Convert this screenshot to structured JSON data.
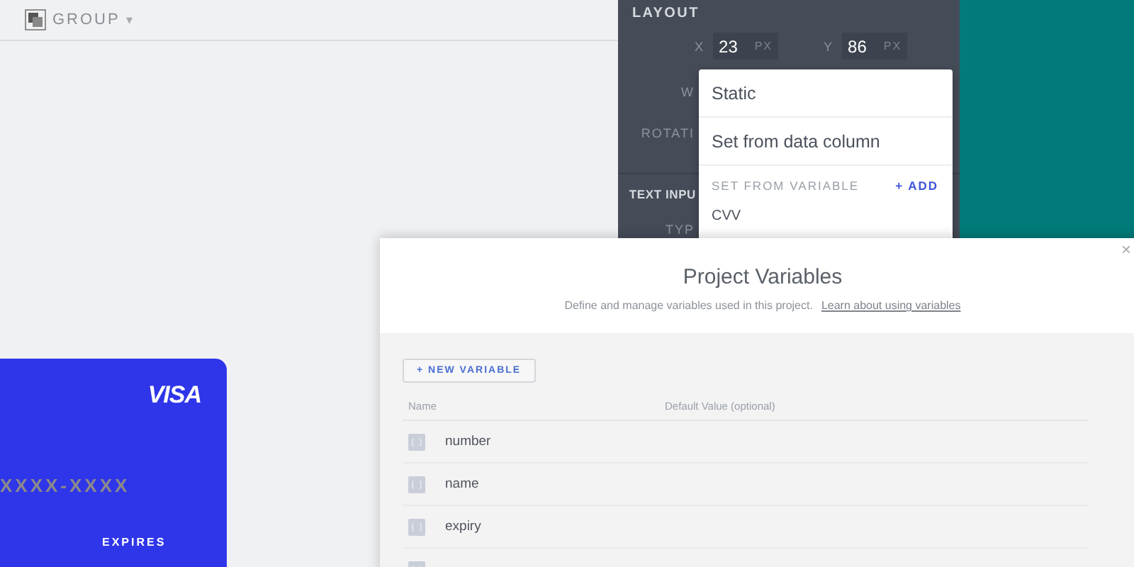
{
  "toolbar": {
    "label": "GROUP",
    "caret": "▾"
  },
  "card": {
    "brand": "VISA",
    "number": "XXXX-XXXX",
    "expires_label": "EXPIRES"
  },
  "panel": {
    "section": "LAYOUT",
    "x": {
      "label": "X",
      "value": "23",
      "unit": "PX"
    },
    "y": {
      "label": "Y",
      "value": "86",
      "unit": "PX"
    },
    "labels": [
      "W",
      "ROTATI"
    ],
    "section_2": "TEXT INPU",
    "label_2": "TYP"
  },
  "dropdown": {
    "items": [
      "Static",
      "Set from data column"
    ],
    "variable_header": "SET FROM VARIABLE",
    "add": "+ ADD",
    "variables": [
      "CVV"
    ]
  },
  "modal": {
    "title": "Project Variables",
    "subtitle": "Define and manage variables used in this project.",
    "link": "Learn about using variables",
    "close": "×",
    "new_button": "+ NEW VARIABLE",
    "columns": [
      "Name",
      "Default Value (optional)"
    ],
    "rows": [
      {
        "name": "number"
      },
      {
        "name": "name"
      },
      {
        "name": "expiry"
      },
      {
        "name": ""
      }
    ]
  }
}
